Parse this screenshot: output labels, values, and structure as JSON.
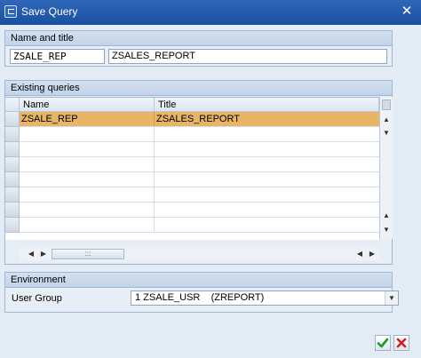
{
  "window": {
    "title": "Save Query"
  },
  "name_group": {
    "header": "Name and title",
    "name_value": "ZSALE_REP",
    "title_value": "ZSALES_REPORT"
  },
  "queries_group": {
    "header": "Existing queries",
    "columns": [
      "Name",
      "Title"
    ],
    "rows": [
      {
        "name": "ZSALE_REP",
        "title": "ZSALES_REPORT",
        "selected": true
      }
    ]
  },
  "environment_group": {
    "header": "Environment",
    "user_group_label": "User Group",
    "user_group_value": "1 ZSALE_USR    (ZREPORT)"
  },
  "colors": {
    "selection": "#e8b466",
    "title_bar": "#1a4f9f"
  },
  "icons": {
    "confirm": "checkmark-icon",
    "cancel": "x-icon"
  }
}
